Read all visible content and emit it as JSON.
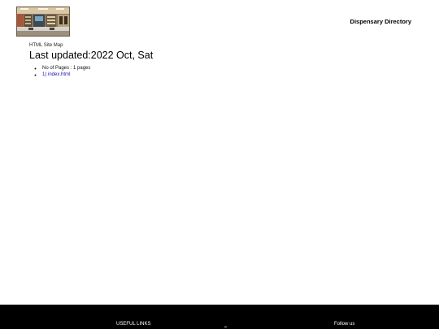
{
  "header": {
    "logo_alt": "dispensary interior photo",
    "brand_title": "Dispensary Directory"
  },
  "main": {
    "caption": "HTML Site Map",
    "last_updated": "Last updated:2022 Oct, Sat",
    "items": [
      {
        "text": "No of Pages : 1 pages",
        "link": false
      },
      {
        "text": "1) index.html",
        "link": true
      }
    ]
  },
  "footer": {
    "useful_links": "USEFUL LINKS",
    "follow_us": "Follow us"
  },
  "colors": {
    "link": "#1a0dab",
    "footer_bg": "#000000"
  }
}
